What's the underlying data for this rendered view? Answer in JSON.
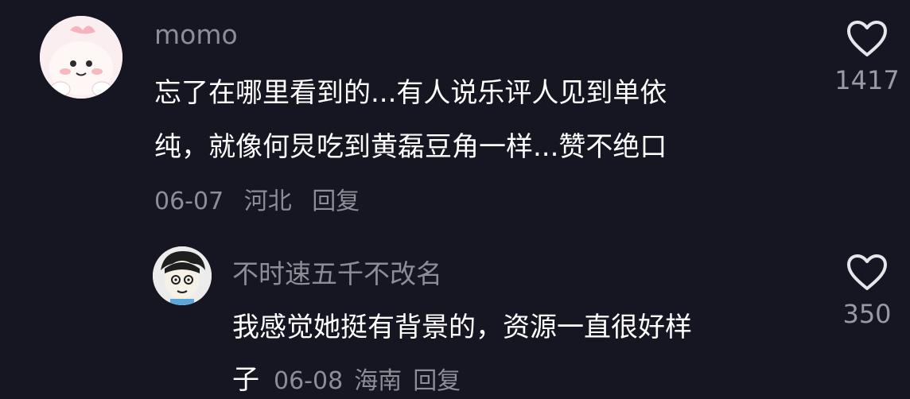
{
  "comments": [
    {
      "username": "momo",
      "text_lines": [
        "忘了在哪里看到的...有人说乐评人见到单依",
        "纯，就像何炅吃到黄磊豆角一样...赞不绝口"
      ],
      "date": "06-07",
      "location": "河北",
      "reply_label": "回复",
      "like_count": "1417",
      "icon": "heart-outline-icon"
    },
    {
      "username": "不时速五千不改名",
      "text_lines": [
        "我感觉她挺有背景的，资源一直很好样",
        "子"
      ],
      "date": "06-08",
      "location": "海南",
      "reply_label": "回复",
      "like_count": "350",
      "icon": "heart-outline-icon"
    }
  ],
  "colors": {
    "background": "#161622",
    "secondary_text": "#8d8d96",
    "primary_text": "#ffffff"
  }
}
